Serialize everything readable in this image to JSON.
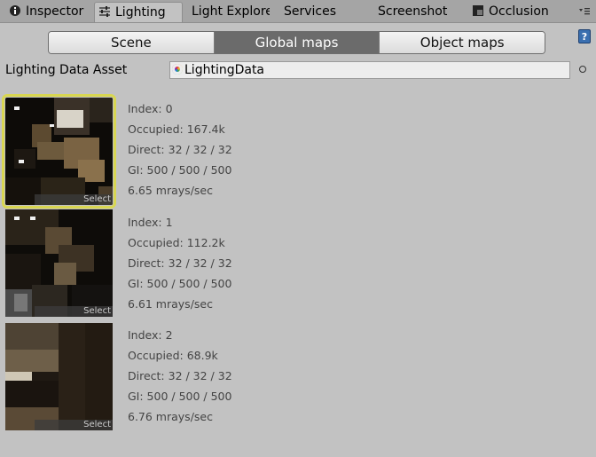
{
  "tabs": [
    {
      "label": "Inspector",
      "icon": "info-icon"
    },
    {
      "label": "Lighting",
      "icon": "lighting-settings-icon"
    },
    {
      "label": "Light Explore",
      "icon": ""
    },
    {
      "label": "Services",
      "icon": ""
    },
    {
      "label": "Screenshot",
      "icon": ""
    },
    {
      "label": "Occlusion",
      "icon": "occlusion-icon"
    }
  ],
  "toolbar": {
    "scene_label": "Scene",
    "global_maps_label": "Global maps",
    "object_maps_label": "Object maps"
  },
  "help_label": "?",
  "lighting_data_asset": {
    "label": "Lighting Data Asset",
    "value": "LightingData",
    "icon": "lighting-data-asset-icon"
  },
  "lightmaps": [
    {
      "index": "Index: 0",
      "occupied": "Occupied: 167.4k",
      "direct": "Direct: 32 / 32 / 32",
      "gi": "GI: 500 / 500 / 500",
      "rays": "6.65 mrays/sec",
      "select": "Select",
      "selected": true
    },
    {
      "index": "Index: 1",
      "occupied": "Occupied: 112.2k",
      "direct": "Direct: 32 / 32 / 32",
      "gi": "GI: 500 / 500 / 500",
      "rays": "6.61 mrays/sec",
      "select": "Select",
      "selected": false
    },
    {
      "index": "Index: 2",
      "occupied": "Occupied: 68.9k",
      "direct": "Direct: 32 / 32 / 32",
      "gi": "GI: 500 / 500 / 500",
      "rays": "6.76 mrays/sec",
      "select": "Select",
      "selected": false
    }
  ],
  "colors": {
    "panel": "#c2c2c2",
    "tabbar": "#a5a5a5",
    "active_segment": "#6b6b6b",
    "selection_outline": "#d8d651"
  }
}
